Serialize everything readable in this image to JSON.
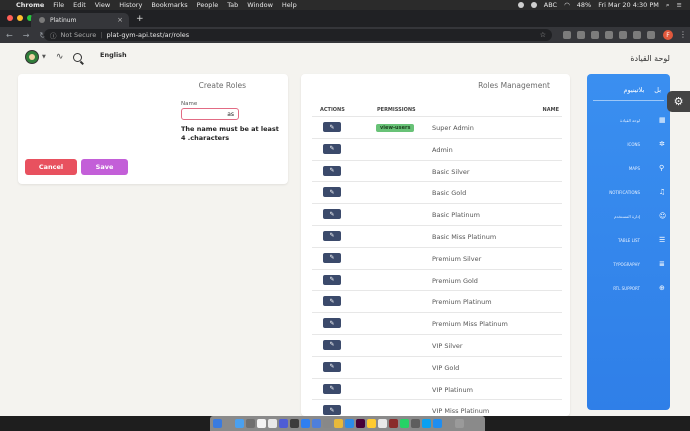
{
  "menubar": {
    "app": "Chrome",
    "items": [
      "File",
      "Edit",
      "View",
      "History",
      "Bookmarks",
      "People",
      "Tab",
      "Window",
      "Help"
    ],
    "input_source": "ABC",
    "battery": "48%",
    "clock": "Fri Mar 20  4:30 PM"
  },
  "browser": {
    "tab_title": "Platinum",
    "not_secure": "Not Secure",
    "url": "plat-gym-api.test/ar/roles",
    "profile_initial": "F"
  },
  "header": {
    "language": "English",
    "brand_ar": "لوحة القيادة"
  },
  "create_roles": {
    "title": "Create Roles",
    "name_label": "Name",
    "name_value": "as",
    "error": "The name must be at least 4 .characters",
    "cancel_label": "Cancel",
    "save_label": "Save"
  },
  "roles_management": {
    "title": "Roles Management",
    "columns": {
      "actions": "ACTIONS",
      "permissions": "PERMISSIONS",
      "name": "NAME"
    },
    "rows": [
      {
        "name": "Super Admin",
        "permission": "view-users"
      },
      {
        "name": "Admin",
        "permission": ""
      },
      {
        "name": "Basic Silver",
        "permission": ""
      },
      {
        "name": "Basic Gold",
        "permission": ""
      },
      {
        "name": "Basic Platinum",
        "permission": ""
      },
      {
        "name": "Basic Miss Platinum",
        "permission": ""
      },
      {
        "name": "Premium Silver",
        "permission": ""
      },
      {
        "name": "Premium Gold",
        "permission": ""
      },
      {
        "name": "Premium Platinum",
        "permission": ""
      },
      {
        "name": "Premium Miss Platinum",
        "permission": ""
      },
      {
        "name": "VIP Silver",
        "permission": ""
      },
      {
        "name": "VIP Gold",
        "permission": ""
      },
      {
        "name": "VIP Platinum",
        "permission": ""
      },
      {
        "name": "VIP Miss Platinum",
        "permission": ""
      }
    ]
  },
  "sidebar": {
    "brand_short": "بل",
    "brand": "بلاتينيوم",
    "items": [
      {
        "label": "لوحة القيادة",
        "icon": "dashboard-icon"
      },
      {
        "label": "ICONS",
        "icon": "atom-icon"
      },
      {
        "label": "MAPS",
        "icon": "pin-icon"
      },
      {
        "label": "NOTIFICATIONS",
        "icon": "bell-icon"
      },
      {
        "label": "إدارة المستخدم",
        "icon": "user-icon"
      },
      {
        "label": "TABLE LIST",
        "icon": "list-icon"
      },
      {
        "label": "TYPOGRAPHY",
        "icon": "text-icon"
      },
      {
        "label": "RTL SUPPORT",
        "icon": "globe-icon"
      }
    ]
  },
  "colors": {
    "sidebar": "#2f7fe8",
    "cancel": "#e8515f",
    "save": "#c35fd8",
    "permission_badge": "#68c277",
    "edit_button": "#3b4a6b"
  }
}
